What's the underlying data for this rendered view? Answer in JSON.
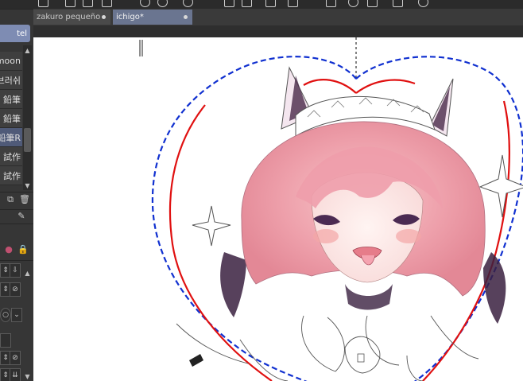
{
  "document_tabs": [
    {
      "label": "zakuro pequeño",
      "active": false
    },
    {
      "label": "ichigo*",
      "active": true
    }
  ],
  "brush_panel": {
    "selected_label": "tel",
    "items": [
      {
        "label": "moon",
        "active": false
      },
      {
        "label": "브러쉬",
        "active": false
      },
      {
        "label": "鉛筆",
        "active": false
      },
      {
        "label": "鉛筆",
        "active": false
      },
      {
        "label": "鉛筆R",
        "active": true
      },
      {
        "label": "試作",
        "active": false
      },
      {
        "label": "試作",
        "active": false
      }
    ]
  },
  "colors": {
    "accent": "#7e8cb3",
    "active_tab": "#6a7590",
    "guide_red": "#e01010",
    "guide_blue": "#1030d0"
  },
  "icons": [
    "new-layer-icon",
    "trash-icon",
    "lock-icon",
    "download-icon",
    "reset-icon",
    "scroll-up-icon",
    "scroll-down-icon"
  ]
}
